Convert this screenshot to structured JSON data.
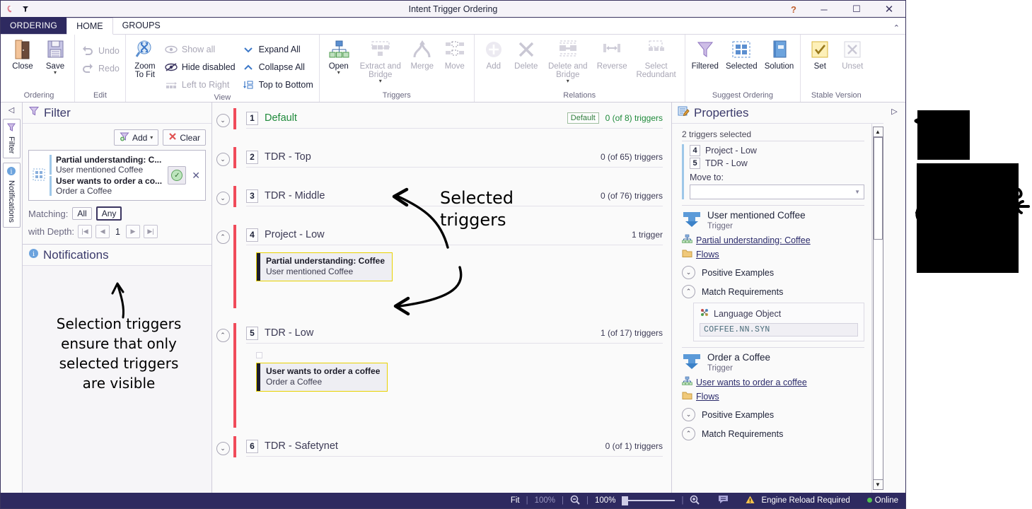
{
  "window": {
    "title": "Intent Trigger Ordering",
    "quick_access": [
      "app-logo",
      "customize-qat"
    ],
    "controls": {
      "help": "?",
      "minimize": "─",
      "maximize": "☐",
      "close": "✕",
      "ribbon_collapse": "⌃"
    }
  },
  "tabs": [
    {
      "label": "ORDERING",
      "kind": "file"
    },
    {
      "label": "HOME",
      "kind": "active"
    },
    {
      "label": "GROUPS",
      "kind": "normal"
    }
  ],
  "ribbon": {
    "groups": [
      {
        "title": "Ordering",
        "buttons": [
          {
            "label": "Close",
            "icon": "door-icon",
            "disabled": false,
            "split": false
          },
          {
            "label": "Save",
            "icon": "floppy-disk-icon",
            "disabled": false,
            "split": true
          }
        ]
      },
      {
        "title": "Edit",
        "buttons": [
          {
            "label": "Undo",
            "icon": "undo-arrow-icon",
            "disabled": true
          },
          {
            "label": "Redo",
            "icon": "redo-arrow-icon",
            "disabled": true
          }
        ]
      },
      {
        "title": "View",
        "buttons": [
          {
            "label": "Zoom\nTo Fit",
            "icon": "zoom-to-fit-icon",
            "disabled": false
          },
          {
            "label": "Show all",
            "icon": "eye-icon",
            "disabled": true
          },
          {
            "label": "Hide disabled",
            "icon": "eye-slash-icon",
            "disabled": false
          },
          {
            "label": "Left to Right",
            "icon": "left-to-right-icon",
            "disabled": true
          },
          {
            "label": "Expand All",
            "icon": "chevron-down-icon",
            "disabled": false
          },
          {
            "label": "Collapse All",
            "icon": "chevron-up-icon",
            "disabled": false
          },
          {
            "label": "Top to Bottom",
            "icon": "top-to-bottom-icon",
            "disabled": false
          }
        ]
      },
      {
        "title": "Triggers",
        "buttons": [
          {
            "label": "Open",
            "icon": "hierarchy-icon",
            "disabled": false,
            "split": true
          },
          {
            "label": "Extract and Bridge",
            "icon": "extract-bridge-icon",
            "disabled": true,
            "split": true
          },
          {
            "label": "Merge",
            "icon": "merge-arrow-icon",
            "disabled": true
          },
          {
            "label": "Move",
            "icon": "move-nodes-icon",
            "disabled": true
          }
        ]
      },
      {
        "title": "Relations",
        "buttons": [
          {
            "label": "Add",
            "icon": "plus-circle-icon",
            "disabled": true
          },
          {
            "label": "Delete",
            "icon": "cross-icon",
            "disabled": true
          },
          {
            "label": "Delete and Bridge",
            "icon": "delete-bridge-icon",
            "disabled": true,
            "split": true
          },
          {
            "label": "Reverse",
            "icon": "reverse-arrow-icon",
            "disabled": true
          },
          {
            "label": "Select Redundant",
            "icon": "select-redundant-icon",
            "disabled": true
          }
        ]
      },
      {
        "title": "Suggest Ordering",
        "buttons": [
          {
            "label": "Filtered",
            "icon": "funnel-icon",
            "disabled": false
          },
          {
            "label": "Selected",
            "icon": "selection-grid-icon",
            "disabled": false
          },
          {
            "label": "Solution",
            "icon": "solution-book-icon",
            "disabled": false
          }
        ]
      },
      {
        "title": "Stable Version",
        "buttons": [
          {
            "label": "Set",
            "icon": "checkmark-icon",
            "disabled": false
          },
          {
            "label": "Unset",
            "icon": "cross-icon",
            "disabled": true
          }
        ]
      }
    ]
  },
  "left_rail": {
    "collapse_icon": "collapse-left-icon",
    "tabs": [
      {
        "label": "Filter",
        "icon": "funnel-icon"
      },
      {
        "label": "Notifications",
        "icon": "info-circle-icon"
      }
    ]
  },
  "filter_panel": {
    "title": "Filter",
    "title_icon": "funnel-icon",
    "add_label": "Add",
    "clear_label": "Clear",
    "items": [
      {
        "title": "Partial understanding: C...",
        "subtitle": "User mentioned Coffee"
      },
      {
        "title": "User wants to order a co...",
        "subtitle": "Order a Coffee"
      }
    ],
    "enabled_toggle": "enabled",
    "remove_icon": "close-icon",
    "matching_label": "Matching:",
    "matching_options": [
      "All",
      "Any"
    ],
    "matching_selected": "Any",
    "depth_label": "with Depth:",
    "depth_value": "1"
  },
  "notifications_panel": {
    "title": "Notifications",
    "title_icon": "info-circle-icon"
  },
  "annotations": {
    "left_note": [
      "Selection triggers",
      "ensure that only",
      "selected triggers",
      "are visible"
    ],
    "center_note": [
      "Selected",
      "triggers"
    ]
  },
  "groups": [
    {
      "num": "1",
      "name": "Default",
      "badge": "Default",
      "count": "0 (of 8) triggers",
      "expanded": false,
      "highlight": true,
      "triggers": []
    },
    {
      "num": "2",
      "name": "TDR - Top",
      "badge": null,
      "count": "0 (of 65) triggers",
      "expanded": false,
      "highlight": false,
      "triggers": []
    },
    {
      "num": "3",
      "name": "TDR - Middle",
      "badge": null,
      "count": "0 (of 76) triggers",
      "expanded": false,
      "highlight": false,
      "triggers": []
    },
    {
      "num": "4",
      "name": "Project - Low",
      "badge": null,
      "count": "1 trigger",
      "expanded": true,
      "highlight": false,
      "triggers": [
        {
          "title": "Partial understanding: Coffee",
          "subtitle": "User mentioned Coffee",
          "selected": true
        }
      ]
    },
    {
      "num": "5",
      "name": "TDR - Low",
      "badge": null,
      "count": "1 (of 17) triggers",
      "expanded": true,
      "highlight": false,
      "triggers": [
        {
          "title": "User wants to order a coffee",
          "subtitle": "Order a Coffee",
          "selected": true
        }
      ]
    },
    {
      "num": "6",
      "name": "TDR - Safetynet",
      "badge": null,
      "count": "0 (of 1) triggers",
      "expanded": false,
      "highlight": false,
      "triggers": []
    }
  ],
  "properties": {
    "title": "Properties",
    "title_icon": "properties-pencil-icon",
    "selection_summary": "2 triggers selected",
    "selected_groups": [
      {
        "num": "4",
        "name": "Project - Low"
      },
      {
        "num": "5",
        "name": "TDR - Low"
      }
    ],
    "move_to_label": "Move to:",
    "move_to_value": "",
    "trigger_details": [
      {
        "name": "User mentioned Coffee",
        "type": "Trigger",
        "link": "Partial understanding: Coffee",
        "link_icon": "hierarchy-icon",
        "flows_label": "Flows",
        "flows_icon": "folder-icon",
        "sections": [
          {
            "label": "Positive Examples",
            "expanded": false
          },
          {
            "label": "Match Requirements",
            "expanded": true
          }
        ],
        "language_object": {
          "label": "Language Object",
          "icon": "language-object-icon",
          "value": "COFFEE.NN.SYN"
        }
      },
      {
        "name": "Order a Coffee",
        "type": "Trigger",
        "link": "User wants to order a coffee",
        "link_icon": "hierarchy-icon",
        "flows_label": "Flows",
        "flows_icon": "folder-icon",
        "sections": [
          {
            "label": "Positive Examples",
            "expanded": false
          },
          {
            "label": "Match Requirements",
            "expanded": true
          }
        ],
        "language_object": null
      }
    ],
    "expand_right_icon": "expand-right-icon"
  },
  "status_bar": {
    "fit_label": "Fit",
    "fit_percent": "100%",
    "zoom_out_icon": "zoom-out-icon",
    "zoom_percent": "100%",
    "zoom_in_icon": "zoom-in-icon",
    "comment_icon": "comment-icon",
    "warning_icon": "warning-icon",
    "warning_text": "Engine Reload Required",
    "online_text": "Online"
  },
  "colors": {
    "accent_dark": "#2e2a60",
    "group_bar": "#f04b5a",
    "selected_card_border": "#e8d200",
    "online_green": "#4fc24f",
    "warning_yellow": "#f2c14e",
    "link_blue": "#2b2b6b"
  }
}
